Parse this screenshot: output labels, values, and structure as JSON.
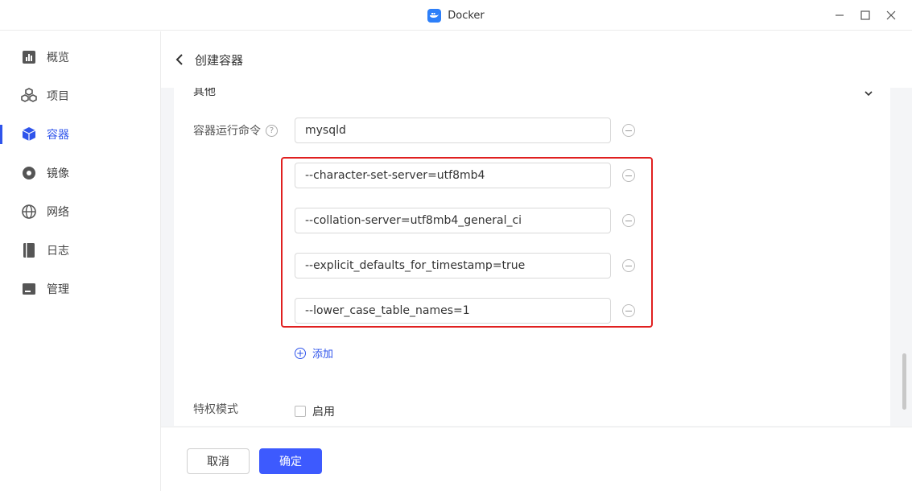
{
  "window": {
    "title": "Docker",
    "icon": "docker-whale-icon",
    "controls": [
      "minimize-icon",
      "maximize-icon",
      "close-icon"
    ]
  },
  "sidebar": {
    "items": [
      {
        "label": "概览",
        "icon": "overview-chart-icon",
        "active": false
      },
      {
        "label": "项目",
        "icon": "cubes-icon",
        "active": false
      },
      {
        "label": "容器",
        "icon": "container-cube-icon",
        "active": true
      },
      {
        "label": "镜像",
        "icon": "disc-icon",
        "active": false
      },
      {
        "label": "网络",
        "icon": "globe-icon",
        "active": false
      },
      {
        "label": "日志",
        "icon": "book-icon",
        "active": false
      },
      {
        "label": "管理",
        "icon": "manage-panel-icon",
        "active": false
      }
    ]
  },
  "header": {
    "title": "创建容器"
  },
  "form": {
    "section_title": "其他",
    "command_label": "容器运行命令",
    "commands": [
      "mysqld",
      "--character-set-server=utf8mb4",
      "--collation-server=utf8mb4_general_ci",
      "--explicit_defaults_for_timestamp=true",
      "--lower_case_table_names=1"
    ],
    "add_label": "添加",
    "privileged_label": "特权模式",
    "privileged_checkbox_label": "启用",
    "privileged_checked": false
  },
  "footer": {
    "cancel_label": "取消",
    "confirm_label": "确定"
  },
  "colors": {
    "accent": "#2f54eb",
    "primary_button": "#3d5afe",
    "highlight_border": "#e02020"
  }
}
